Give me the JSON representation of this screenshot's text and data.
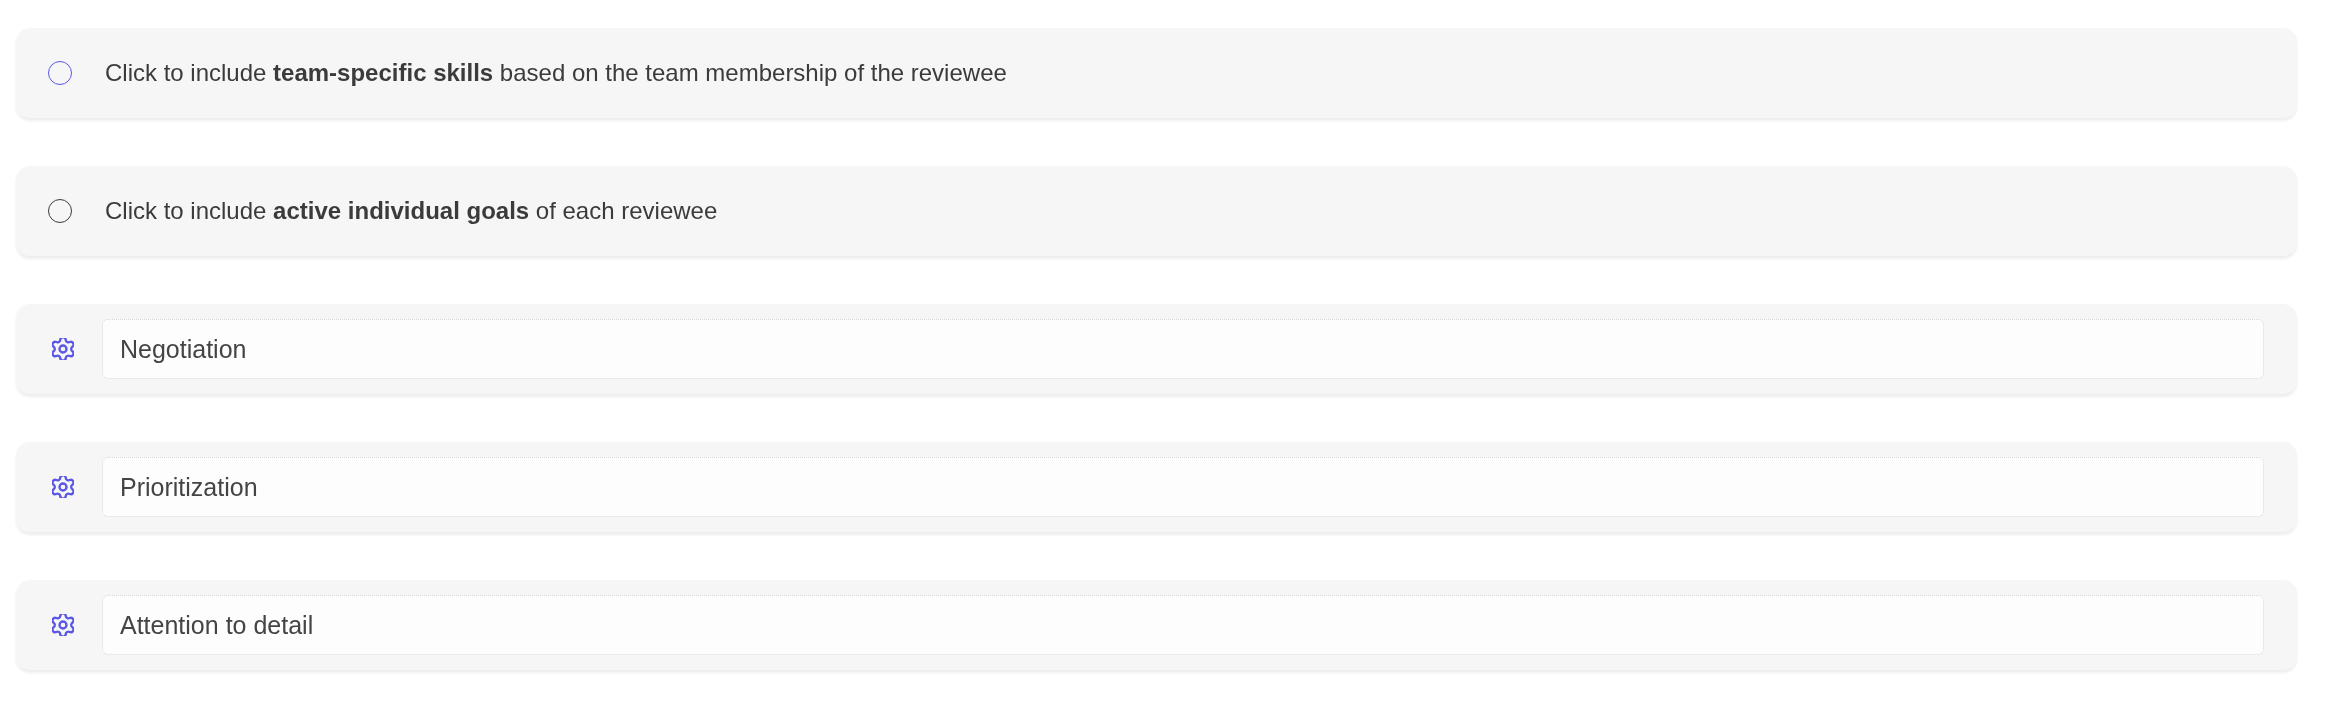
{
  "options": [
    {
      "text": "Click to include **team-specific skills** based on the team membership of the reviewee",
      "checked": false,
      "color": "#5b57e6"
    },
    {
      "text": "Click to include **active individual goals** of each reviewee",
      "checked": false,
      "color": "#3a3a3a"
    }
  ],
  "skills": [
    {
      "value": "Negotiation"
    },
    {
      "value": "Prioritization"
    },
    {
      "value": "Attention to detail"
    }
  ]
}
